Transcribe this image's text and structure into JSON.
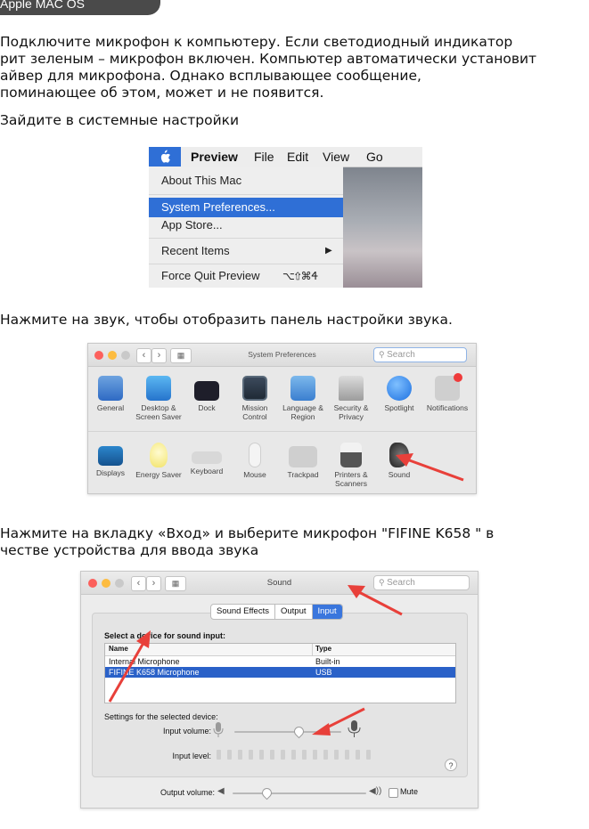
{
  "header": {
    "label": "Apple MAC OS"
  },
  "intro": [
    "Подключите микрофон к компьютеру. Если светодиодный индикатор",
    "рит зеленым – микрофон включен. Компьютер автоматически установит",
    "айвер для микрофона. Однако всплывающее сообщение,",
    "поминающее об этом, может и не появится."
  ],
  "step1": "Зайдите в системные настройки",
  "menu": {
    "app": "Preview",
    "items_bar": [
      "File",
      "Edit",
      "View",
      "Go"
    ],
    "about": "About This Mac",
    "sysprefs": "System Preferences...",
    "appstore": "App Store...",
    "recent": "Recent Items",
    "forcequit": "Force Quit Preview",
    "shortcut": "⌥⇧⌘Ꮞ",
    "arrow": "▶",
    "accent": "#2f6fd6"
  },
  "step2": "Нажмите на звук, чтобы отобразить панель настройки звука.",
  "syspref": {
    "title": "System Preferences",
    "search": "Search",
    "row1": [
      "General",
      "Desktop & Screen Saver",
      "Dock",
      "Mission Control",
      "Language & Region",
      "Security & Privacy",
      "Spotlight",
      "Notifications"
    ],
    "row2": [
      "Displays",
      "Energy Saver",
      "Keyboard",
      "Mouse",
      "Trackpad",
      "Printers & Scanners",
      "Sound"
    ]
  },
  "step3": [
    "Нажмите на вкладку «Вход» и выберите микрофон \"FIFINE K658 \" в",
    "честве устройства для ввода звука"
  ],
  "sound": {
    "title": "Sound",
    "search": "Search",
    "tabs": [
      "Sound Effects",
      "Output",
      "Input"
    ],
    "select_label": "Select a device for sound input:",
    "col_name": "Name",
    "col_type": "Type",
    "rows": [
      {
        "name": "Internal Microphone",
        "type": "Built-in"
      },
      {
        "name": "FIFINE K658 Microphone",
        "type": "USB"
      }
    ],
    "settings_label": "Settings for the selected device:",
    "input_volume": "Input volume:",
    "input_level": "Input level:",
    "help": "?",
    "output_volume": "Output volume:",
    "mute": "Mute",
    "input_volume_value": 0.6,
    "output_volume_value": 0.25
  },
  "colors": {
    "arrow": "#e8403a",
    "selection": "#2a61c8"
  }
}
